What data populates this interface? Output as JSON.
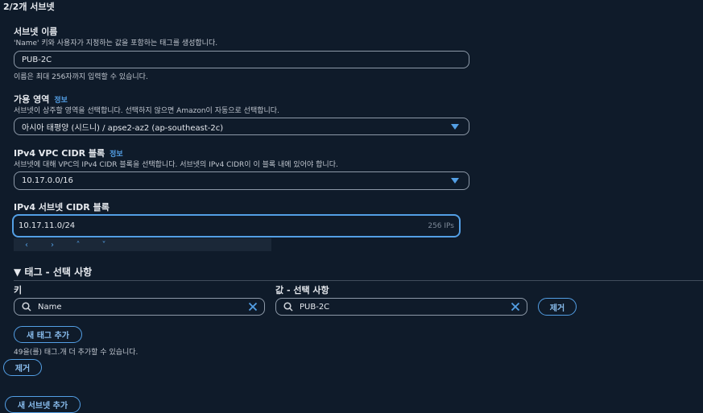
{
  "header": {
    "title": "2/2개 서브넷"
  },
  "subnet_name": {
    "label": "서브넷 이름",
    "description": "'Name' 키와 사용자가 지정하는 값을 포함하는 태그를 생성합니다.",
    "value": "PUB-2C",
    "hint": "이름은 최대 256자까지 입력할 수 있습니다."
  },
  "availability_zone": {
    "label": "가용 영역",
    "info": "정보",
    "description": "서브넷이 상주할 영역을 선택합니다. 선택하지 않으면 Amazon이 자동으로 선택합니다.",
    "value": "아시아 태평양 (시드니) / apse2-az2 (ap-southeast-2c)"
  },
  "vpc_cidr": {
    "label": "IPv4 VPC CIDR 블록",
    "info": "정보",
    "description": "서브넷에 대해 VPC의 IPv4 CIDR 블록을 선택합니다. 서브넷의 IPv4 CIDR이 이 블록 내에 있어야 합니다.",
    "value": "10.17.0.0/16"
  },
  "subnet_cidr": {
    "label": "IPv4 서브넷 CIDR 블록",
    "value": "10.17.11.0/24",
    "ip_count": "256 IPs",
    "stepper": [
      "‹",
      "›",
      "˄",
      "˅"
    ]
  },
  "tags": {
    "section_title": "▼ 태그 - 선택 사항",
    "key_label": "키",
    "value_label": "값 - 선택 사항",
    "rows": [
      {
        "key": "Name",
        "value": "PUB-2C",
        "remove_label": "제거"
      }
    ],
    "add_label": "새 태그 추가",
    "limit_text": "49을(를) 태그.개 더 추가할 수 있습니다."
  },
  "remove_subnet_label": "제거",
  "add_subnet_label": "새 서브넷 추가",
  "colors": {
    "accent": "#539fe5",
    "background": "#0f1b2a",
    "border": "#8d99a8"
  },
  "icons": {
    "search": "search-icon",
    "clear": "close-icon",
    "dropdown": "caret-down-icon"
  }
}
